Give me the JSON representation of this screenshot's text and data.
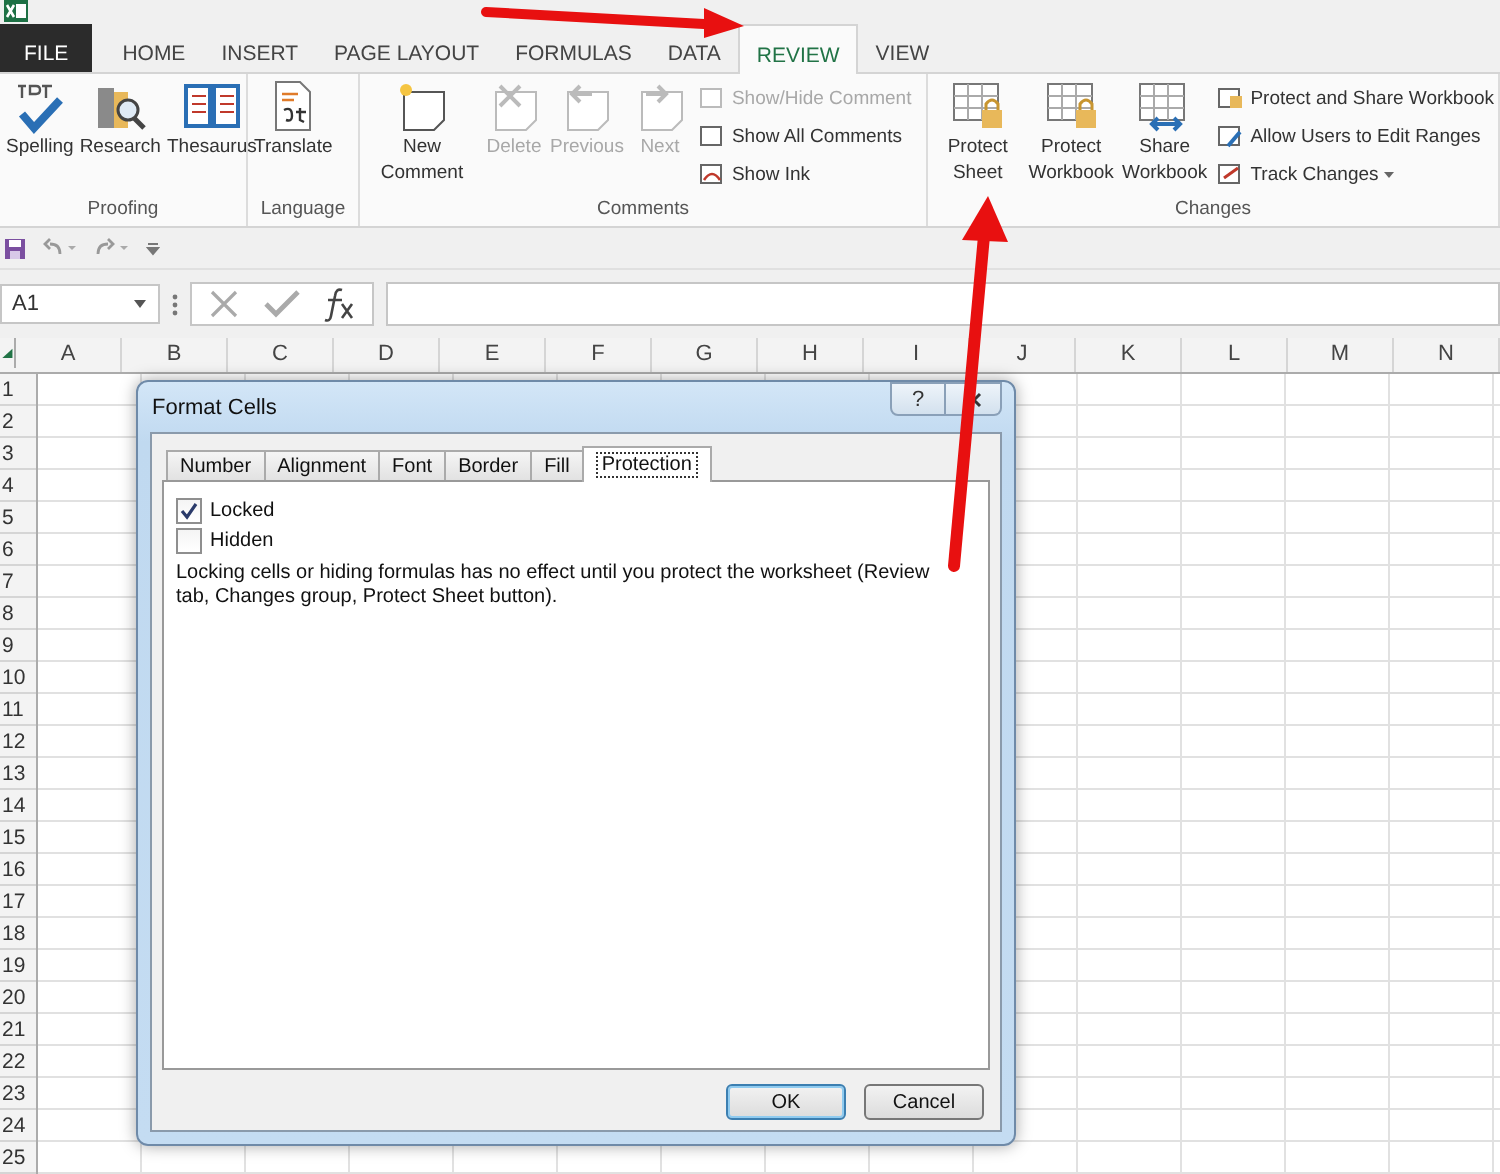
{
  "ribbon_tabs": [
    {
      "label": "FILE",
      "kind": "file",
      "selected": false
    },
    {
      "label": "HOME",
      "kind": "tab",
      "selected": false
    },
    {
      "label": "INSERT",
      "kind": "tab",
      "selected": false
    },
    {
      "label": "PAGE LAYOUT",
      "kind": "tab",
      "selected": false
    },
    {
      "label": "FORMULAS",
      "kind": "tab",
      "selected": false
    },
    {
      "label": "DATA",
      "kind": "tab",
      "selected": false
    },
    {
      "label": "REVIEW",
      "kind": "tab",
      "selected": true
    },
    {
      "label": "VIEW",
      "kind": "tab",
      "selected": false
    }
  ],
  "ribbon_groups": [
    {
      "label": "Proofing",
      "items": [
        {
          "kind": "large",
          "label": "Spelling",
          "disabled": false
        },
        {
          "kind": "large",
          "label": "Research",
          "disabled": false
        },
        {
          "kind": "large",
          "label": "Thesaurus",
          "disabled": false
        }
      ]
    },
    {
      "label": "Language",
      "items": [
        {
          "kind": "large",
          "label": "Translate",
          "disabled": false
        }
      ]
    },
    {
      "label": "Comments",
      "items": [
        {
          "kind": "large",
          "label": "New Comment",
          "disabled": false
        },
        {
          "kind": "large",
          "label": "Delete",
          "disabled": true
        },
        {
          "kind": "large",
          "label": "Previous",
          "disabled": true
        },
        {
          "kind": "large",
          "label": "Next",
          "disabled": true
        },
        {
          "kind": "small",
          "label": "Show/Hide Comment",
          "disabled": true
        },
        {
          "kind": "small",
          "label": "Show All Comments",
          "disabled": false
        },
        {
          "kind": "small",
          "label": "Show Ink",
          "disabled": false
        }
      ]
    },
    {
      "label": "Changes",
      "items": [
        {
          "kind": "large",
          "label": "Protect Sheet",
          "disabled": false
        },
        {
          "kind": "large",
          "label": "Protect Workbook",
          "disabled": false
        },
        {
          "kind": "large",
          "label": "Share Workbook",
          "disabled": false
        },
        {
          "kind": "small",
          "label": "Protect and Share Workbook",
          "disabled": false
        },
        {
          "kind": "small",
          "label": "Allow Users to Edit Ranges",
          "disabled": false
        },
        {
          "kind": "small",
          "label": "Track Changes",
          "disabled": false,
          "has_menu": true
        }
      ]
    }
  ],
  "name_box": {
    "value": "A1"
  },
  "column_headers": [
    "A",
    "B",
    "C",
    "D",
    "E",
    "F",
    "G",
    "H",
    "I",
    "J",
    "K",
    "L",
    "M",
    "N"
  ],
  "row_headers": [
    "1",
    "2",
    "3",
    "4",
    "5",
    "6",
    "7",
    "8",
    "9",
    "10",
    "11",
    "12",
    "13",
    "14",
    "15",
    "16",
    "17",
    "18",
    "19",
    "20",
    "21",
    "22",
    "23",
    "24",
    "25"
  ],
  "dialog": {
    "title": "Format Cells",
    "help": "?",
    "tabs": [
      {
        "label": "Number",
        "selected": false
      },
      {
        "label": "Alignment",
        "selected": false
      },
      {
        "label": "Font",
        "selected": false
      },
      {
        "label": "Border",
        "selected": false
      },
      {
        "label": "Fill",
        "selected": false
      },
      {
        "label": "Protection",
        "selected": true
      }
    ],
    "checkboxes": [
      {
        "label": "Locked",
        "checked": true
      },
      {
        "label": "Hidden",
        "checked": false
      }
    ],
    "note": "Locking cells or hiding formulas has no effect until you protect the worksheet (Review tab, Changes group, Protect Sheet button).",
    "buttons": [
      {
        "label": "OK",
        "default": true
      },
      {
        "label": "Cancel",
        "default": false
      }
    ]
  }
}
